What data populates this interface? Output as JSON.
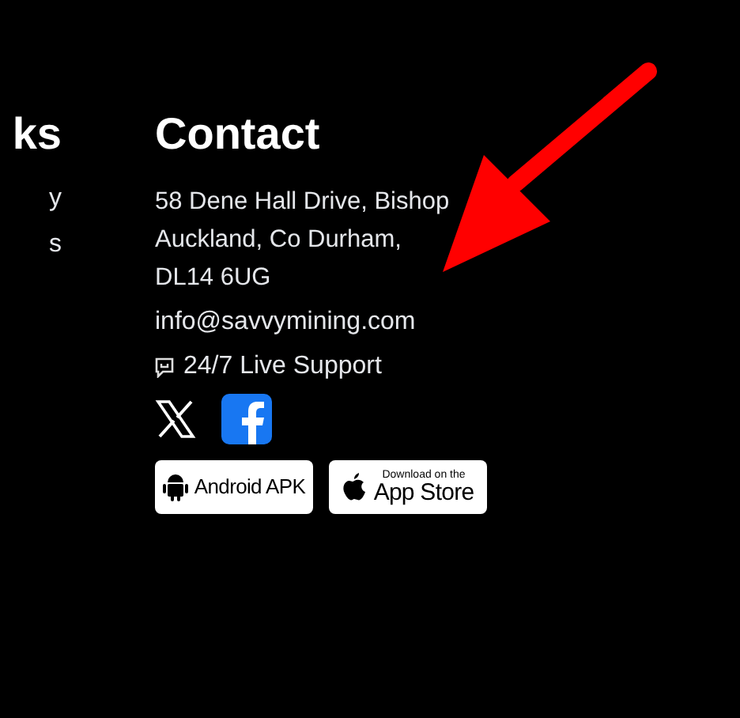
{
  "links_column": {
    "heading": "ks",
    "items": [
      "y",
      "s"
    ]
  },
  "contact": {
    "heading": "Contact",
    "address": [
      "58 Dene Hall Drive, Bishop",
      "Auckland, Co Durham,",
      "DL14 6UG"
    ],
    "email": "info@savvymining.com",
    "support": "24/7 Live Support"
  },
  "app_buttons": [
    {
      "kind": "android",
      "label": "Android APK"
    },
    {
      "kind": "apple",
      "small_label": "Download on the",
      "label": "App Store"
    }
  ]
}
